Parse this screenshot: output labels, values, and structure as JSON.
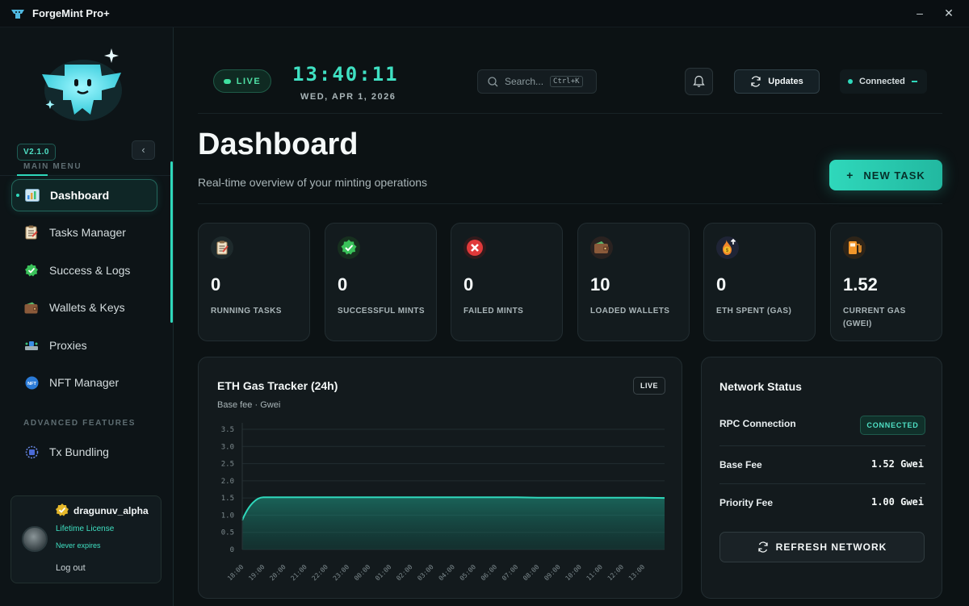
{
  "app": {
    "title": "ForgeMint Pro+",
    "minimize_icon": "minimize-icon",
    "close_icon": "close-icon"
  },
  "sidebar": {
    "version": "V2.1.0",
    "main_menu_label": "MAIN MENU",
    "advanced_label": "ADVANCED FEATURES",
    "items": [
      {
        "label": "Dashboard",
        "icon": "dashboard-icon",
        "active": true
      },
      {
        "label": "Tasks Manager",
        "icon": "clipboard-icon"
      },
      {
        "label": "Success & Logs",
        "icon": "check-badge-icon"
      },
      {
        "label": "Wallets & Keys",
        "icon": "wallet-icon"
      },
      {
        "label": "Proxies",
        "icon": "proxy-icon"
      },
      {
        "label": "NFT Manager",
        "icon": "nft-icon"
      }
    ],
    "advanced_items": [
      {
        "label": "Tx Bundling",
        "icon": "bundle-icon"
      }
    ]
  },
  "user": {
    "username": "dragunuv_alpha",
    "license": "Lifetime License",
    "expires": "Never expires",
    "logout": "Log out"
  },
  "header": {
    "live_label": "LIVE",
    "time": "13:40:11",
    "date": "WED, APR 1, 2026",
    "search_placeholder": "Search...",
    "search_shortcut": "Ctrl+K",
    "updates_label": "Updates",
    "connection_label": "Connected"
  },
  "page": {
    "title": "Dashboard",
    "subtitle": "Real-time overview of your minting operations",
    "new_task_label": "NEW TASK"
  },
  "stats": [
    {
      "value": "0",
      "label": "RUNNING TASKS",
      "icon": "clipboard-icon"
    },
    {
      "value": "0",
      "label": "SUCCESSFUL MINTS",
      "icon": "check-badge-icon"
    },
    {
      "value": "0",
      "label": "FAILED MINTS",
      "icon": "x-circle-icon"
    },
    {
      "value": "10",
      "label": "LOADED WALLETS",
      "icon": "wallet-icon"
    },
    {
      "value": "0",
      "label": "ETH SPENT (GAS)",
      "icon": "fire-money-icon"
    },
    {
      "value": "1.52",
      "label": "CURRENT GAS (GWEI)",
      "icon": "fuel-pump-icon"
    }
  ],
  "chart_data": {
    "type": "area",
    "title": "ETH Gas Tracker (24h)",
    "subtitle": "Base fee · Gwei",
    "badge": "LIVE",
    "x": [
      "18:00",
      "19:00",
      "20:00",
      "21:00",
      "22:00",
      "23:00",
      "00:00",
      "01:00",
      "02:00",
      "03:00",
      "04:00",
      "05:00",
      "06:00",
      "07:00",
      "08:00",
      "09:00",
      "10:00",
      "11:00",
      "12:00",
      "13:00"
    ],
    "y_ticks": [
      "0",
      "0.5",
      "1.0",
      "1.5",
      "2.0",
      "2.5",
      "3.0",
      "3.5"
    ],
    "ylim": [
      0,
      3.5
    ],
    "series": [
      {
        "values": [
          0.85,
          1.52,
          1.52,
          1.52,
          1.52,
          1.52,
          1.52,
          1.52,
          1.52,
          1.52,
          1.52,
          1.52,
          1.52,
          1.52,
          1.51,
          1.51,
          1.51,
          1.51,
          1.51,
          1.51,
          1.5
        ]
      }
    ],
    "grid": true,
    "color": "#2fd8bb"
  },
  "network": {
    "title": "Network Status",
    "rpc_label": "RPC Connection",
    "rpc_status": "CONNECTED",
    "base_fee_label": "Base Fee",
    "base_fee_value": "1.52 Gwei",
    "priority_fee_label": "Priority Fee",
    "priority_fee_value": "1.00 Gwei",
    "refresh_label": "REFRESH NETWORK"
  }
}
